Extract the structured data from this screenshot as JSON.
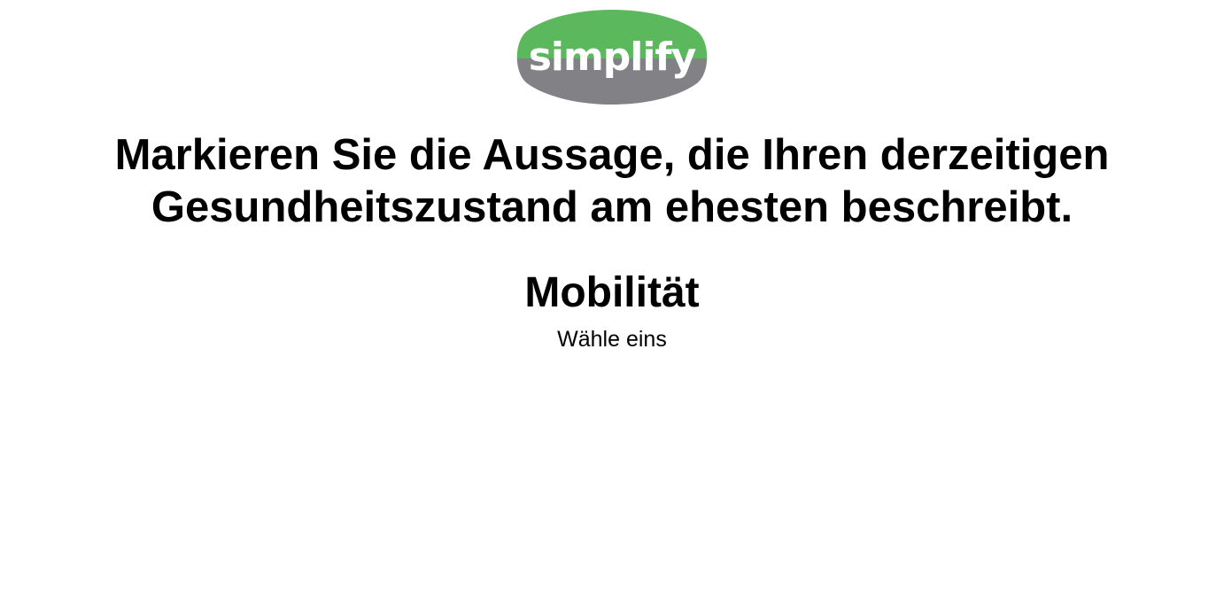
{
  "logo": {
    "text": "simplify",
    "colors": {
      "top": "#5cb85c",
      "bottom": "#828286",
      "text": "#ffffff"
    }
  },
  "question": {
    "line1": "Markieren Sie die Aussage, die Ihren derzeitigen",
    "line2": "Gesundheitszustand am ehesten beschreibt."
  },
  "section": {
    "title": "Mobilität",
    "instruction": "Wähle eins"
  }
}
